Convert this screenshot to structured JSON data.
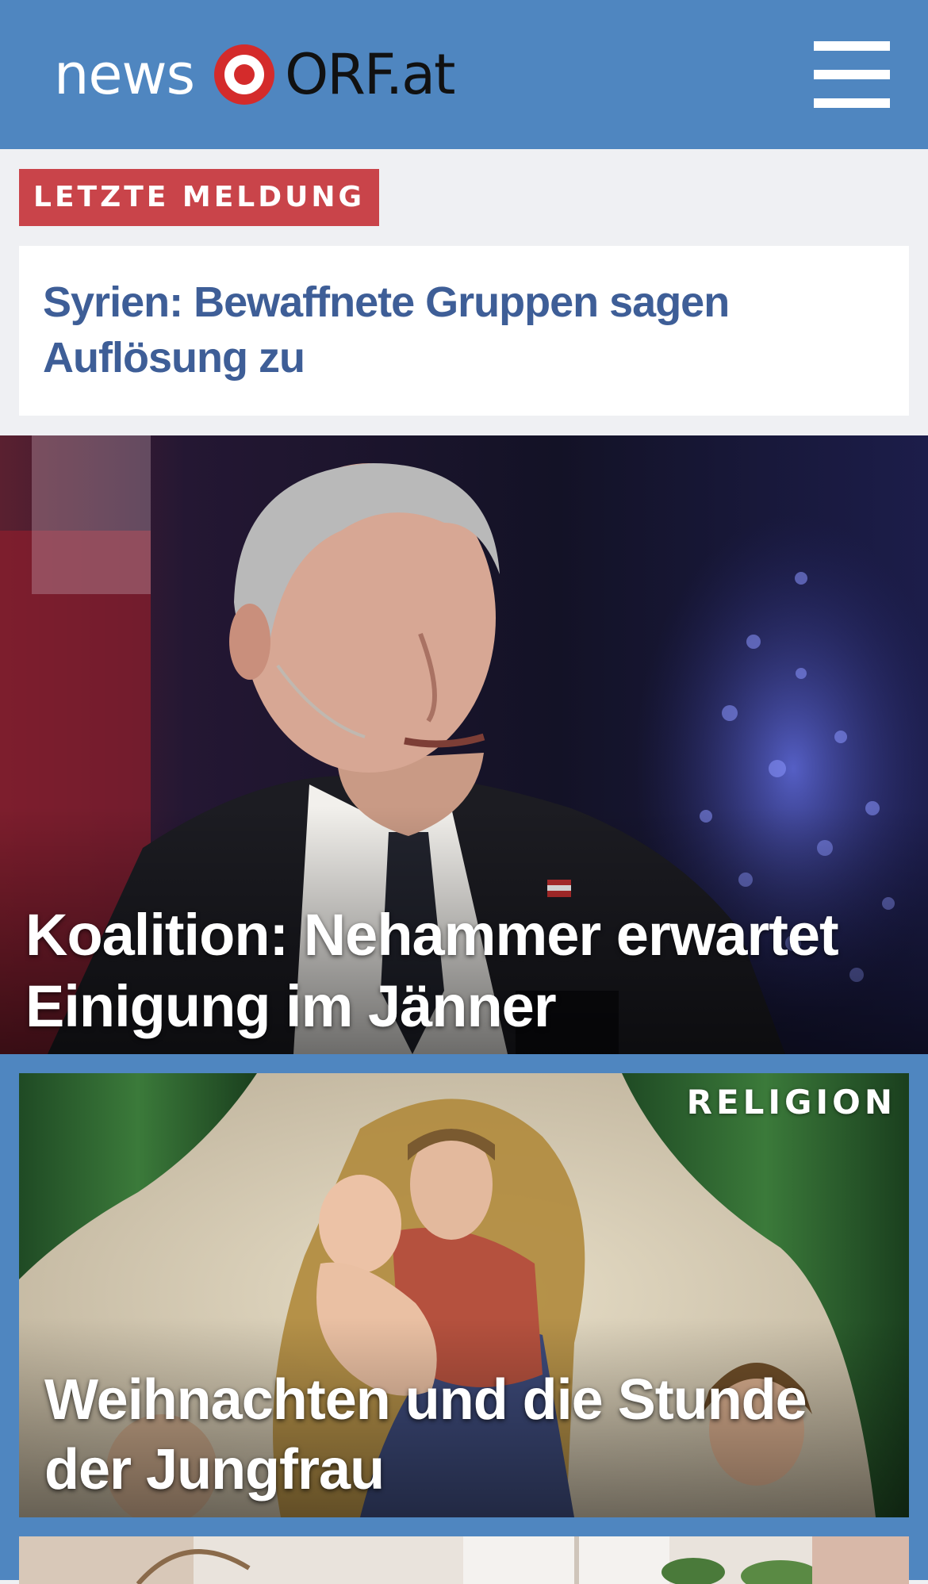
{
  "header": {
    "logo_news": "news",
    "logo_orf": "ORF.at",
    "brand_color": "#4f86c0",
    "logo_red": "#d42b2b",
    "menu_icon": "hamburger-menu-icon"
  },
  "breaking": {
    "label": "LETZTE MELDUNG",
    "headline": "Syrien: Bewaffnete Gruppen sagen Auflösung zu",
    "label_color": "#c9444a",
    "headline_color": "#3e5e97"
  },
  "top_story": {
    "headline": "Koalition: Nehammer erwartet Einigung im Jänner"
  },
  "religion_story": {
    "section": "RELIGION",
    "headline": "Weihnachten und die Stunde der Jungfrau"
  }
}
